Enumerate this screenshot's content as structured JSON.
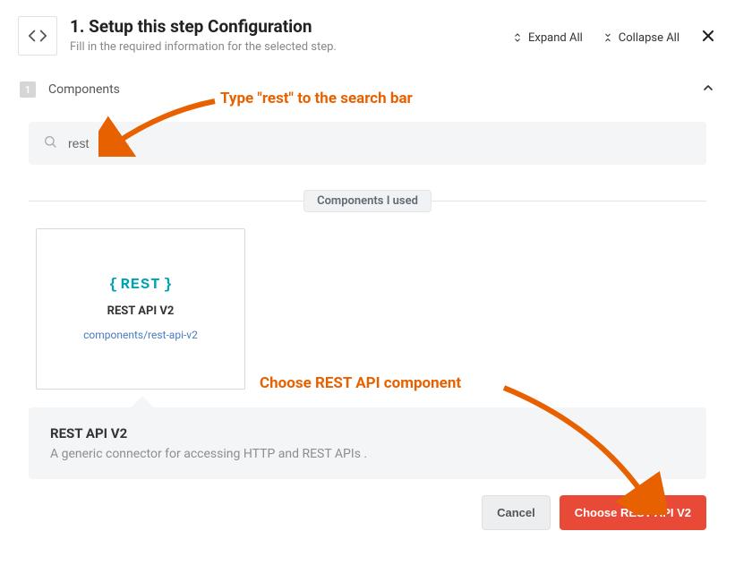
{
  "header": {
    "title": "1. Setup this step Configuration",
    "subtitle": "Fill in the required information for the selected step.",
    "expand_label": "Expand All",
    "collapse_label": "Collapse All"
  },
  "section": {
    "step_number": "1",
    "title": "Components"
  },
  "search": {
    "value": "rest"
  },
  "divider": {
    "label": "Components I used"
  },
  "card": {
    "logo_left": "{",
    "logo_text": "REST",
    "logo_right": "}",
    "title": "REST API V2",
    "subtitle": "components/rest-api-v2"
  },
  "detail": {
    "title": "REST API V2",
    "description": "A generic connector for accessing HTTP and REST APIs ."
  },
  "buttons": {
    "cancel": "Cancel",
    "choose": "Choose REST API V2"
  },
  "annotations": {
    "search_hint": "Type \"rest\" to the search bar",
    "choose_hint": "Choose REST API component"
  }
}
